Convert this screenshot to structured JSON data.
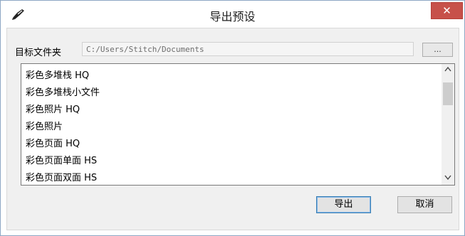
{
  "window": {
    "title": "导出预设",
    "close_label": "✕"
  },
  "folder": {
    "label": "目标文件夹",
    "path": "C:/Users/Stitch/Documents",
    "browse_label": "..."
  },
  "presets": {
    "items": [
      "彩色多堆栈 HQ",
      "彩色多堆栈小文件",
      "彩色照片 HQ",
      "彩色照片",
      "彩色页面 HQ",
      "彩色页面单面 HS",
      "彩色页面双面 HS"
    ],
    "scroll_up": "^",
    "scroll_down": "v"
  },
  "actions": {
    "export_label": "导出",
    "cancel_label": "取消"
  },
  "colors": {
    "close_button": "#c7514a",
    "client_background": "#f0f0f0",
    "default_button_border": "#3c7fb1"
  },
  "icons": {
    "app": "pen-nib-icon",
    "close": "close-icon"
  }
}
